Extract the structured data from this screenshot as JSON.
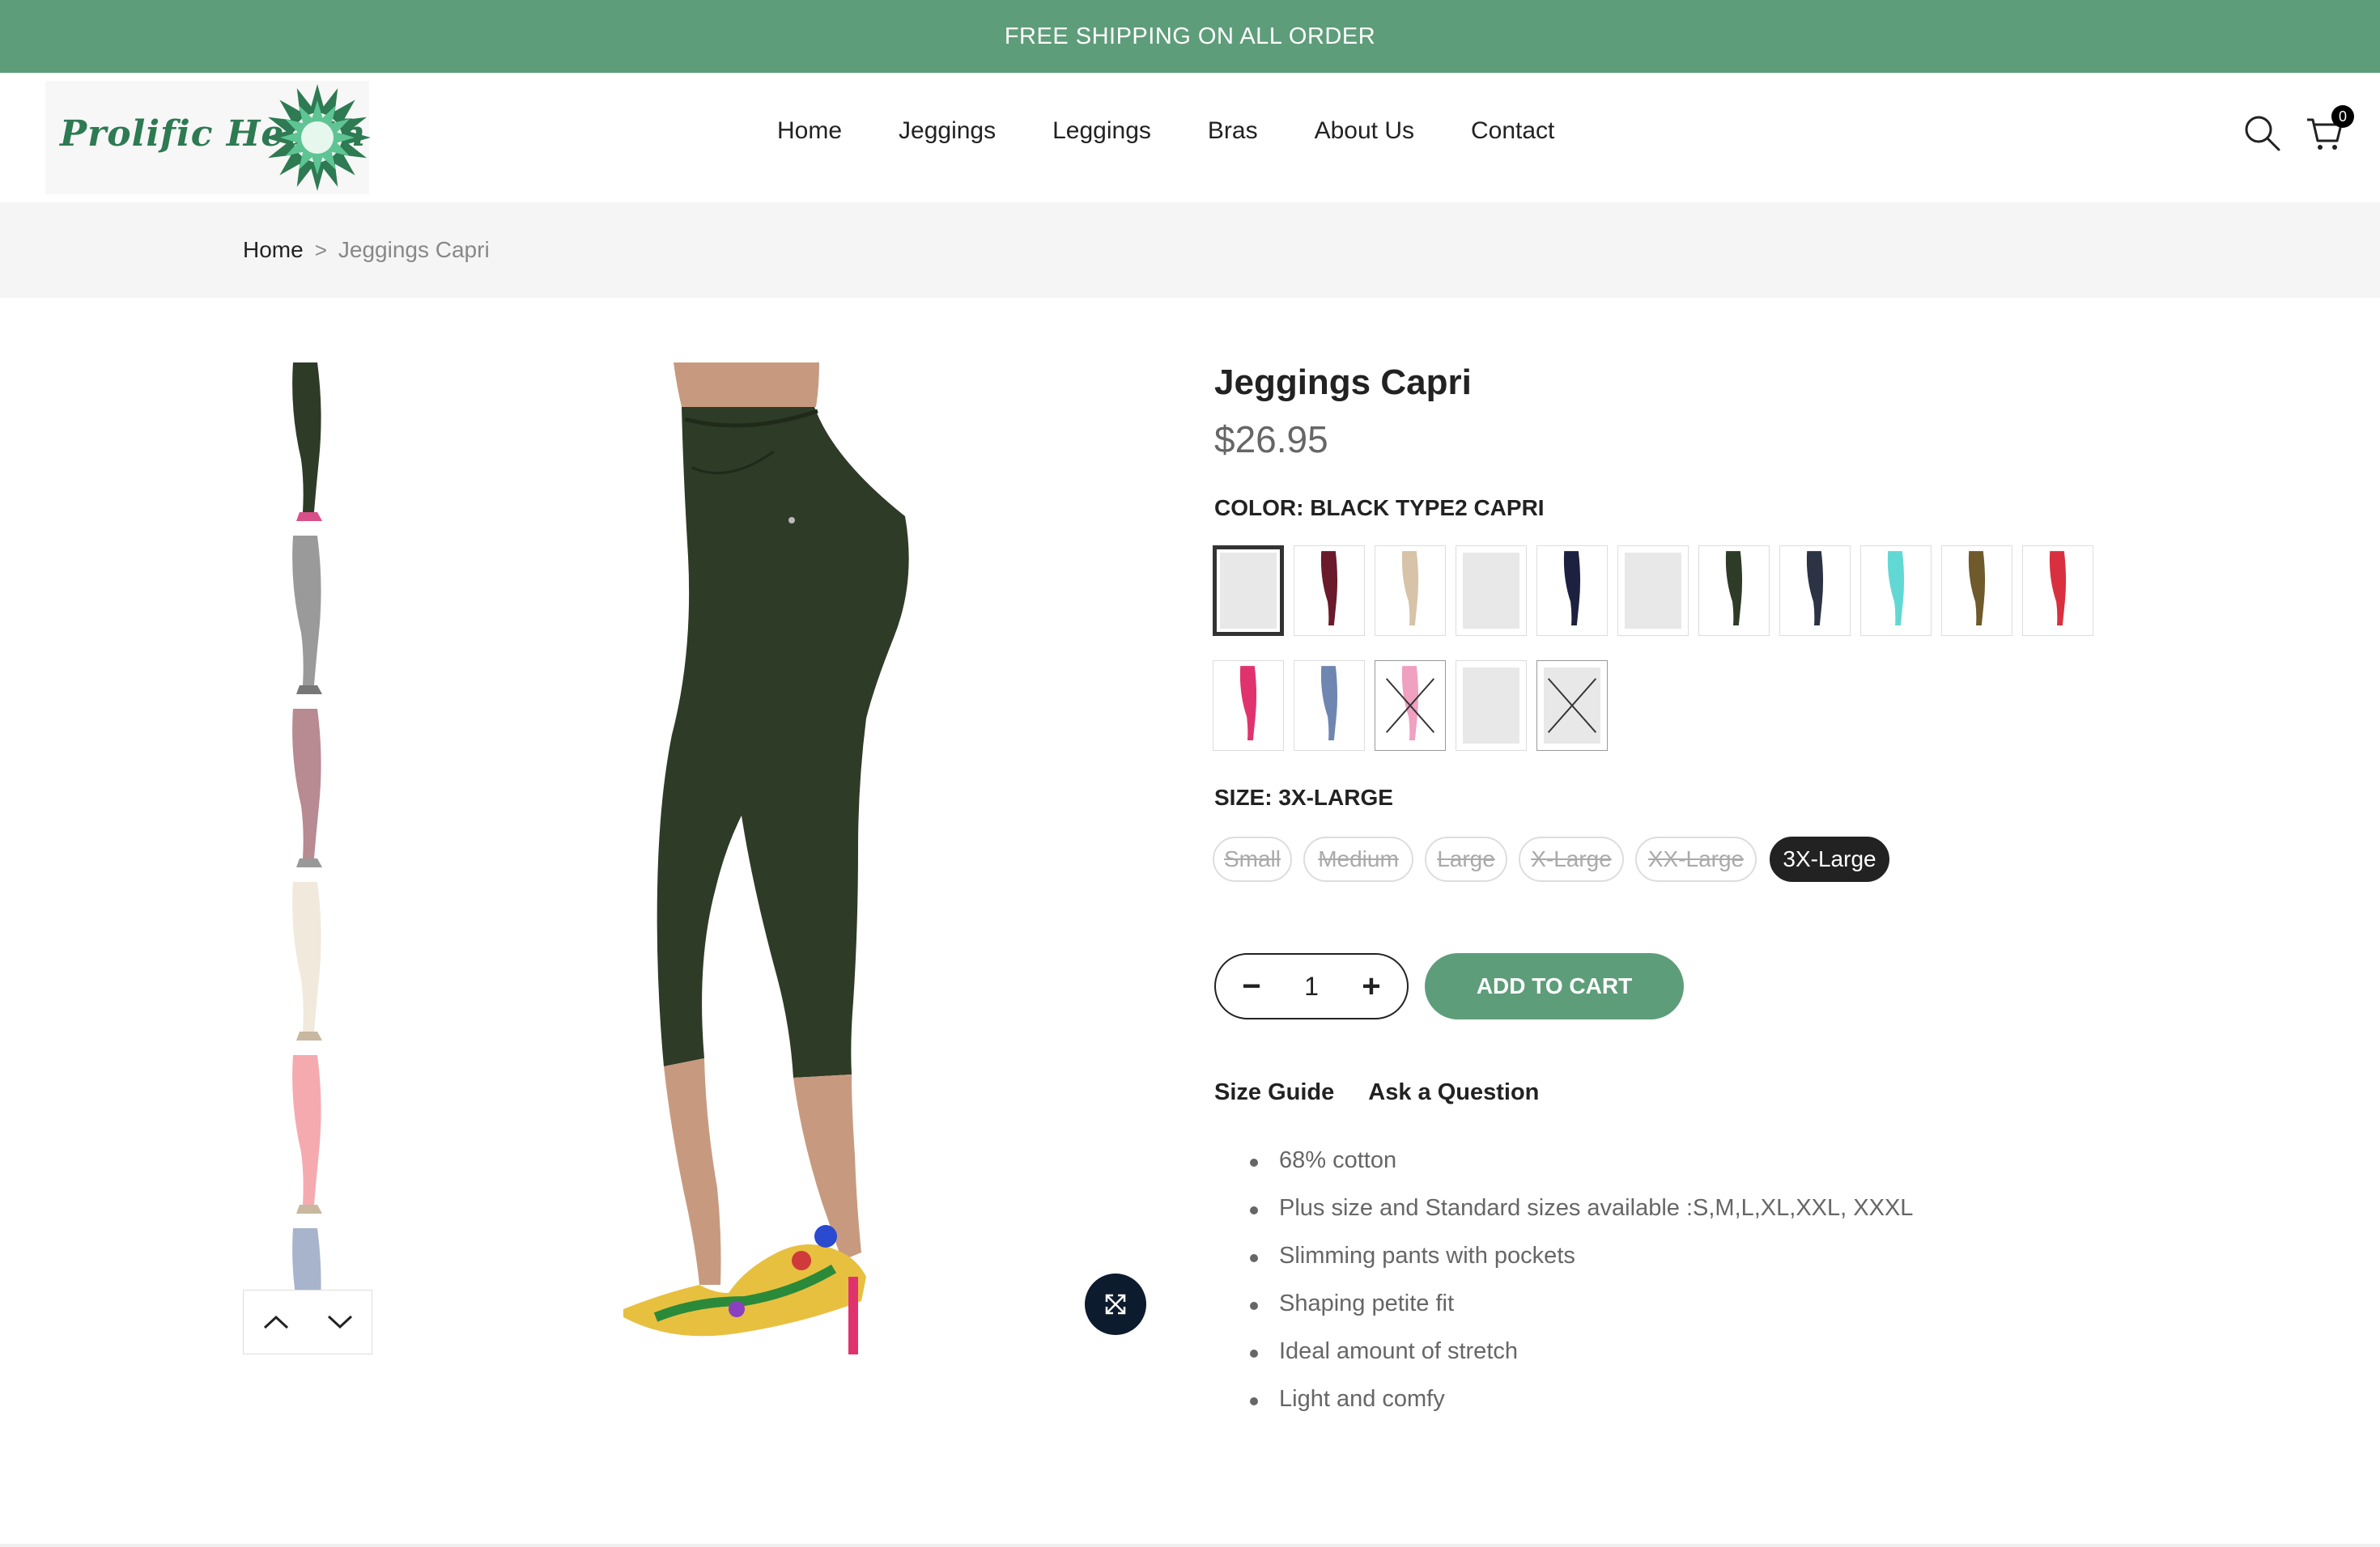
{
  "announcement": {
    "text": "FREE SHIPPING ON ALL ORDER"
  },
  "brand": {
    "name": "Prolific Health",
    "color": "#5e9d7a"
  },
  "nav": {
    "items": [
      "Home",
      "Jeggings",
      "Leggings",
      "Bras",
      "About Us",
      "Contact"
    ]
  },
  "header_icons": {
    "search": "search-icon",
    "cart": "cart-icon",
    "cart_count": "0"
  },
  "breadcrumb": {
    "home": "Home",
    "separator": ">",
    "current": "Jeggings Capri"
  },
  "gallery": {
    "thumbnails": [
      "olive-capri",
      "grey-capri",
      "mauve-capri",
      "cream-capri",
      "pink-capri",
      "blue-capri"
    ],
    "nav_up": "chevron-up-icon",
    "nav_down": "chevron-down-icon",
    "zoom": "expand-icon"
  },
  "product": {
    "title": "Jeggings Capri",
    "price": "$26.95",
    "color_label": "COLOR: BLACK TYPE2 CAPRI",
    "size_label": "SIZE: 3X-LARGE",
    "sizes": [
      {
        "label": "Small",
        "available": false
      },
      {
        "label": "Medium",
        "available": false
      },
      {
        "label": "Large",
        "available": false
      },
      {
        "label": "X-Large",
        "available": false
      },
      {
        "label": "XX-Large",
        "available": false
      },
      {
        "label": "3X-Large",
        "available": true,
        "selected": true
      }
    ],
    "swatch_colors": [
      "#e8e8e8",
      "#6a1a2a",
      "#d6c3a8",
      "#e8e8e8",
      "#1c2140",
      "#e8e8e8",
      "#2e3b27",
      "#2c3344",
      "#62d8d4",
      "#6f5a2c",
      "#d93040",
      "#e0336d",
      "#6f86b0",
      "#f0a0c0",
      "#e8e8e8",
      "#e8e8e8"
    ],
    "quantity": "1",
    "qty_minus": "−",
    "qty_plus": "+",
    "add_to_cart": "ADD TO CART",
    "links": [
      "Size Guide",
      "Ask a Question"
    ],
    "features": [
      "68% cotton",
      "Plus size and Standard sizes available :S,M,L,XL,XXL, XXXL",
      "Slimming pants with pockets",
      "Shaping petite fit",
      "Ideal amount of stretch",
      "Light and comfy"
    ]
  }
}
